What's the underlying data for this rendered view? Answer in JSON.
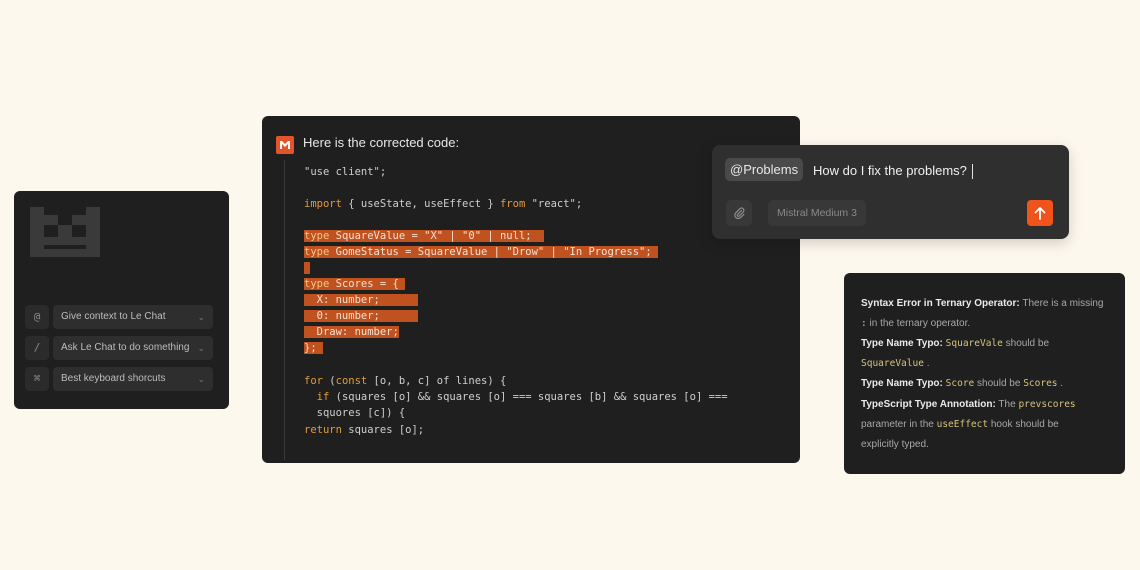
{
  "left_panel": {
    "items": [
      {
        "key": "@",
        "label": "Give context to Le Chat"
      },
      {
        "key": "/",
        "label": "Ask Le Chat to do something"
      },
      {
        "key": "⌘",
        "label": "Best keyboard shorcuts"
      }
    ]
  },
  "code_panel": {
    "header": "Here is the corrected code:",
    "lines": {
      "l1": "\"use client\";",
      "l2a": "import",
      "l2b": " { useState, useEffect } ",
      "l2c": "from",
      "l2d": " \"react\";",
      "l3a": "type",
      "l3b": " SquareValue = \"X\" | \"0\" | null;",
      "l4a": "type",
      "l4b": " GomeStatus = SquareValue | \"Drow\" | \"In Progress\";",
      "l5a": "type",
      "l5b": " Scores = {",
      "l6": "  X: number;",
      "l7": "  0: number;",
      "l8": "  Draw: number;",
      "l9": "};",
      "l10a": "for",
      "l10b": " (",
      "l10c": "const",
      "l10d": " [o, b, c] of lines) {",
      "l11a": "  if",
      "l11b": " (squares [o] && squares [o] === squares [b] && squares [o] ===",
      "l12": "  squores [c]) {",
      "l13a": "return",
      "l13b": " squares [o];"
    }
  },
  "chat_input": {
    "mention": "@Problems",
    "prompt": "How do I fix the problems?",
    "model": "Mistral Medium 3"
  },
  "problems": {
    "p1_title": "Syntax Error in Ternary Operator:",
    "p1_text": " There is a missing",
    "p1_code": ":",
    "p1_text2": " in the ternary operator.",
    "p2_title": "Type Name Typo:",
    "p2_code1": "SquareVale",
    "p2_text": " should be",
    "p2_code2": "SquareValue",
    "p2_end": " .",
    "p3_title": "Type Name Typo:",
    "p3_code1": "Score",
    "p3_text": " should be",
    "p3_code2": "Scores",
    "p3_end": " .",
    "p4_title": "TypeScript Type Annotation:",
    "p4_text": " The",
    "p4_code1": "prevscores",
    "p4_text2": "parameter in the",
    "p4_code2": "useEffect",
    "p4_text3": " hook should be",
    "p4_text4": "explicitly typed."
  },
  "colors": {
    "accent": "#f1541b",
    "highlight": "#c0521f",
    "background": "#fdf8ee",
    "panel": "#1f1f1f"
  }
}
